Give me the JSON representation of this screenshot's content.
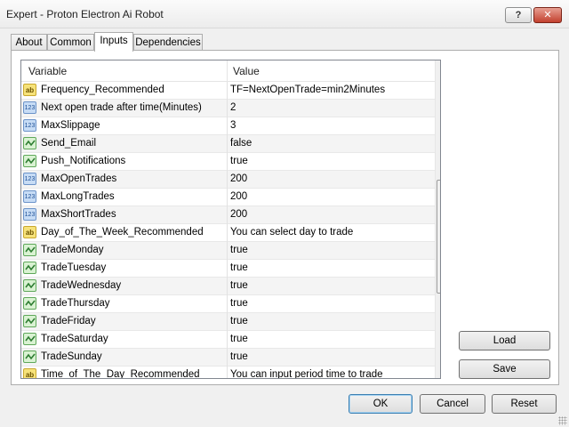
{
  "window": {
    "title": "Expert - Proton Electron Ai Robot",
    "help_label": "?",
    "close_label": "✕"
  },
  "tabs": [
    {
      "label": "About"
    },
    {
      "label": "Common"
    },
    {
      "label": "Inputs",
      "active": true
    },
    {
      "label": "Dependencies"
    }
  ],
  "grid": {
    "headers": {
      "variable": "Variable",
      "value": "Value"
    },
    "rows": [
      {
        "icon": "ab",
        "name": "Frequency_Recommended",
        "value": "TF=NextOpenTrade=min2Minutes"
      },
      {
        "icon": "123",
        "name": "Next open trade after time(Minutes)",
        "value": "2"
      },
      {
        "icon": "123",
        "name": "MaxSlippage",
        "value": "3"
      },
      {
        "icon": "bool",
        "name": "Send_Email",
        "value": "false"
      },
      {
        "icon": "bool",
        "name": "Push_Notifications",
        "value": "true"
      },
      {
        "icon": "123",
        "name": "MaxOpenTrades",
        "value": "200"
      },
      {
        "icon": "123",
        "name": "MaxLongTrades",
        "value": "200"
      },
      {
        "icon": "123",
        "name": "MaxShortTrades",
        "value": "200"
      },
      {
        "icon": "ab",
        "name": "Day_of_The_Week_Recommended",
        "value": "You can select day to trade"
      },
      {
        "icon": "bool",
        "name": "TradeMonday",
        "value": "true"
      },
      {
        "icon": "bool",
        "name": "TradeTuesday",
        "value": "true"
      },
      {
        "icon": "bool",
        "name": "TradeWednesday",
        "value": "true"
      },
      {
        "icon": "bool",
        "name": "TradeThursday",
        "value": "true"
      },
      {
        "icon": "bool",
        "name": "TradeFriday",
        "value": "true"
      },
      {
        "icon": "bool",
        "name": "TradeSaturday",
        "value": "true"
      },
      {
        "icon": "bool",
        "name": "TradeSunday",
        "value": "true"
      },
      {
        "icon": "ab",
        "name": "Time_of_The_Day_Recommended",
        "value": "You can input period time to trade"
      }
    ],
    "icon_labels": {
      "ab": "ab",
      "123": "123"
    }
  },
  "side_buttons": {
    "load": "Load",
    "save": "Save"
  },
  "footer_buttons": {
    "ok": "OK",
    "cancel": "Cancel",
    "reset": "Reset"
  }
}
